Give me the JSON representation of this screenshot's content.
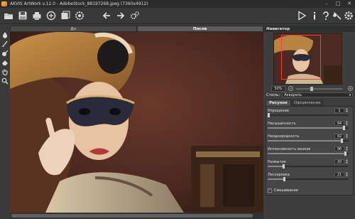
{
  "window": {
    "title": "AKVIS ArtWork v.12.0 - AdobeStock_88197268.jpeg (7360x4912)",
    "minimize": "–",
    "maximize": "□",
    "close": "✕"
  },
  "toolbar": {
    "left_icons": [
      "open-icon",
      "save-icon",
      "print-icon",
      "share-icon",
      "batch-icon",
      "settings-wheel-icon",
      "undo-icon",
      "redo-icon",
      "preferences-gear-icon"
    ],
    "right_icons": [
      "run-icon",
      "info-icon",
      "help-icon",
      "preferences-icon",
      "settings-icon"
    ]
  },
  "canvas": {
    "tab_before": "До",
    "tab_after": "После"
  },
  "navigator": {
    "title": "Навигатор",
    "zoom": "50%",
    "zoom_out": "−",
    "zoom_in": "+"
  },
  "style": {
    "label": "Стиль:",
    "value": "Акварель"
  },
  "panel_tabs": {
    "active": "Рисунок",
    "inactive": "Оформление"
  },
  "params": [
    {
      "label": "Упрощение",
      "value": "1",
      "level": 0.01
    },
    {
      "label": "Насыщенность",
      "value": "94",
      "level": 0.94
    },
    {
      "label": "Неоднородность",
      "value": "92",
      "level": 0.92
    },
    {
      "label": "Интенсивность мазков",
      "value": "96",
      "level": 0.96
    },
    {
      "label": "Размытие",
      "value": "20",
      "level": 0.2
    },
    {
      "label": "Лессировка",
      "value": "21",
      "level": 0.21
    }
  ],
  "blend": {
    "label": "Смешивание",
    "checked": true,
    "mark": "✓"
  },
  "colors": {
    "accent_red": "#ff3b2f",
    "panel_bg": "#3e3e3e"
  }
}
